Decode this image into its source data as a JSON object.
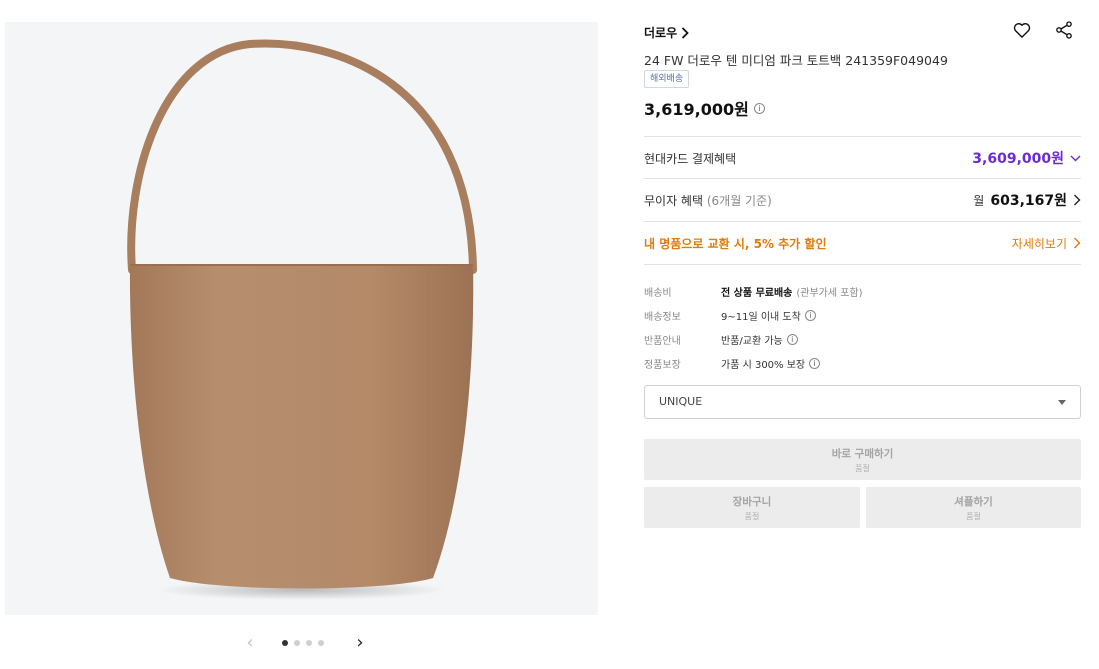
{
  "product": {
    "brand": "더로우",
    "title": "24 FW 더로우 텐 미디엄 파크 토트백 241359F049049",
    "badge": "해외배송",
    "price": "3,619,000원"
  },
  "gallery": {
    "current_index": 1,
    "total": 4
  },
  "card_benefit": {
    "label": "현대카드 결제혜택",
    "amount": "3,609,000원"
  },
  "installment": {
    "label": "무이자 혜택",
    "period": "(6개월 기준)",
    "prefix": "월",
    "amount": "603,167원"
  },
  "trade_in": {
    "label": "내 명품으로 교환 시, 5% 추가 할인",
    "link": "자세히보기"
  },
  "specs": [
    {
      "key": "배송비",
      "value": "전 상품 무료배송",
      "note": "(관부가세 포함)"
    },
    {
      "key": "배송정보",
      "value": "9~11일 이내 도착"
    },
    {
      "key": "반품안내",
      "value": "반품/교환 가능"
    },
    {
      "key": "정품보장",
      "value": "가품 시 300% 보장"
    }
  ],
  "option_select": {
    "value": "UNIQUE"
  },
  "buttons": {
    "buy": {
      "label": "바로 구매하기",
      "status": "품절"
    },
    "cart": {
      "label": "장바구니",
      "status": "품절"
    },
    "gift": {
      "label": "셔플하기",
      "status": "품절"
    }
  },
  "colors": {
    "accent_purple": "#6a2bd6",
    "accent_orange": "#e07a0b",
    "bag_color": "#b48a69"
  },
  "icons": {
    "brand_chevron": "chevron-right-icon",
    "wishlist": "heart-icon",
    "share": "share-icon",
    "card_chevron": "chevron-down-icon",
    "info": "info-icon",
    "select_caret": "caret-down-icon",
    "pager_prev": "chevron-left-icon",
    "pager_next": "chevron-right-icon"
  }
}
